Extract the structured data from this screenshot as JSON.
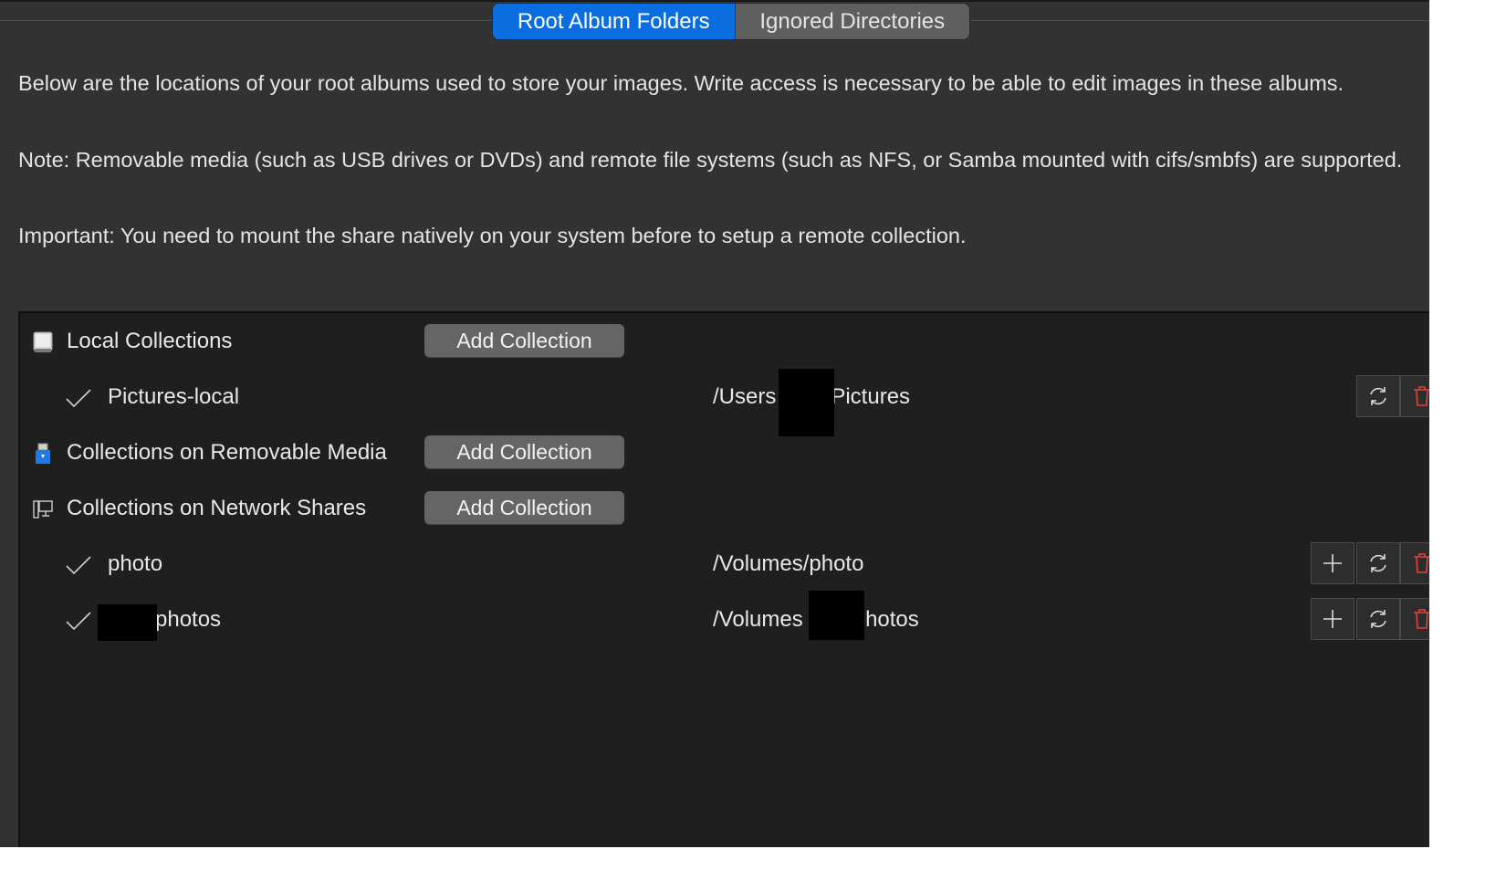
{
  "tabs": [
    {
      "label": "Root Album Folders",
      "active": true
    },
    {
      "label": "Ignored Directories",
      "active": false
    }
  ],
  "description": {
    "p1": "Below are the locations of your root albums used to store your images. Write access is necessary to be able to edit images in these albums.",
    "p2": "Note: Removable media (such as USB drives or DVDs) and remote file systems (such as NFS, or Samba mounted with cifs/smbfs) are supported.",
    "p3": "Important: You need to mount the share natively on your system before to setup a remote collection."
  },
  "categories": {
    "local": {
      "label": "Local Collections",
      "icon": "hard-drive-icon",
      "button": "Add Collection"
    },
    "removable": {
      "label": "Collections on Removable Media",
      "icon": "usb-drive-icon",
      "button": "Add Collection"
    },
    "network": {
      "label": "Collections on Network Shares",
      "icon": "network-computer-icon",
      "button": "Add Collection"
    }
  },
  "collections": {
    "local": [
      {
        "name": "Pictures-local",
        "path_start": "/Users",
        "path_end": "Pictures"
      }
    ],
    "network": [
      {
        "name": "photo",
        "path": "/Volumes/photo"
      },
      {
        "name_end": "photos",
        "path_start": "/Volumes",
        "path_end": "photos"
      }
    ]
  },
  "icons": {
    "check": "checkmark-icon",
    "add": "plus-icon",
    "refresh": "refresh-icon",
    "delete": "trash-icon"
  },
  "colors": {
    "accent": "#0a6ee0",
    "delete": "#e0443a",
    "background": "#323232",
    "tree_background": "#1f1f1f"
  }
}
